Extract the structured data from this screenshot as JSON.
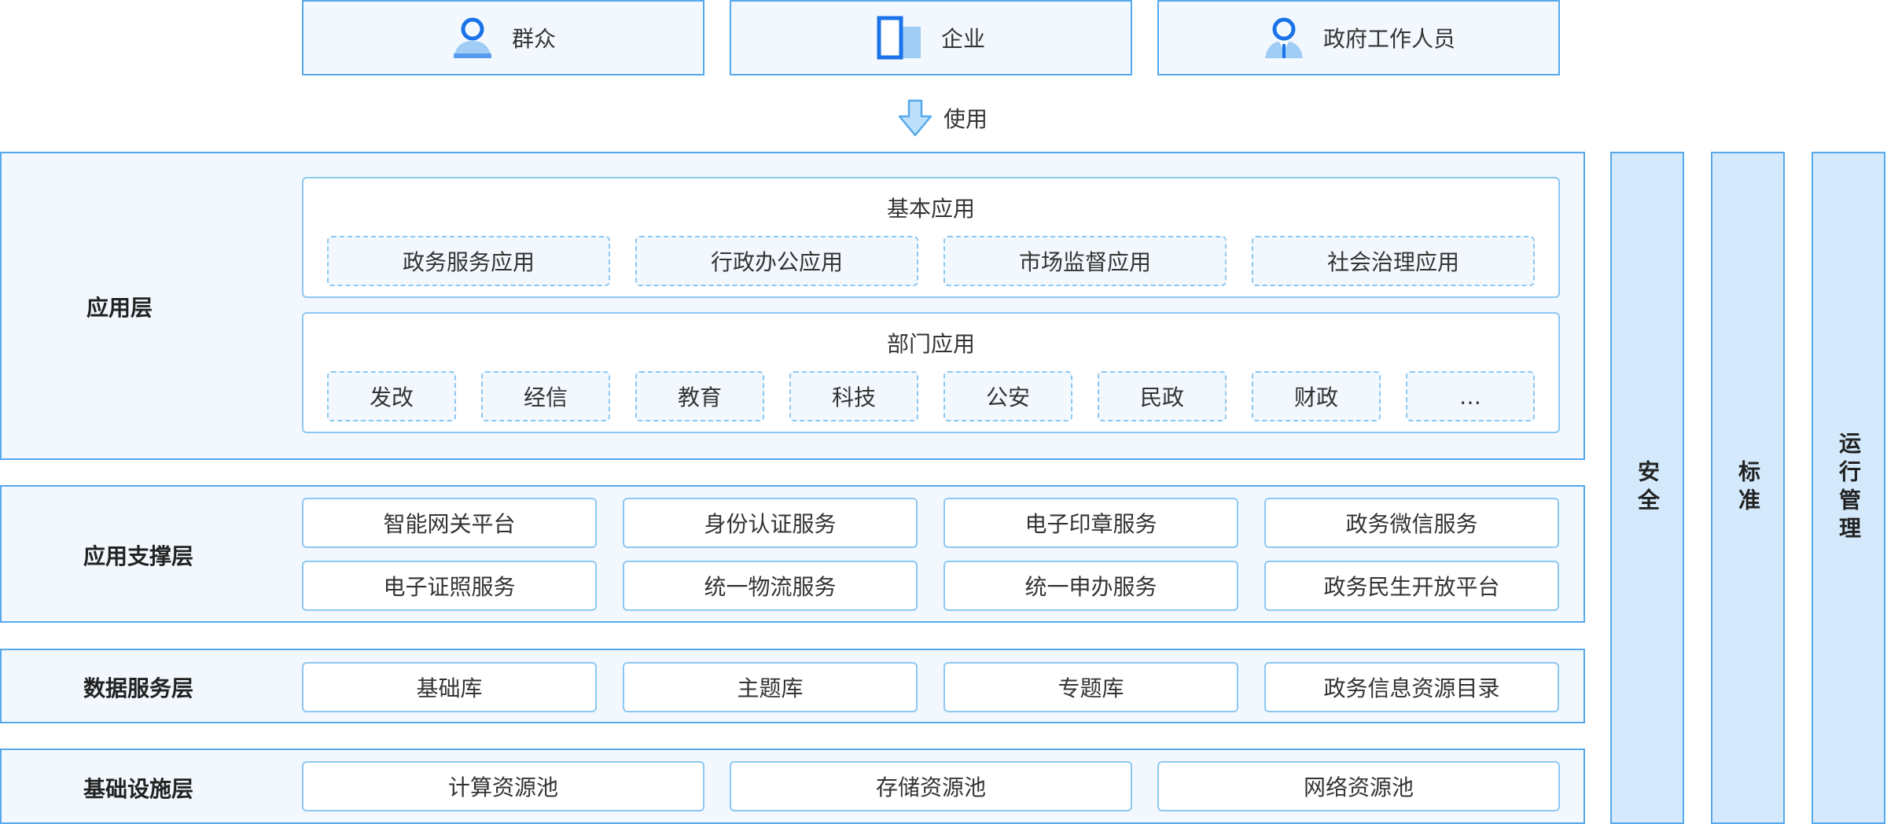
{
  "users": [
    {
      "label": "群众",
      "icon": "person-icon"
    },
    {
      "label": "企业",
      "icon": "building-icon"
    },
    {
      "label": "政府工作人员",
      "icon": "official-icon"
    }
  ],
  "use_label": "使用",
  "app_layer": {
    "title": "应用层",
    "basic": {
      "title": "基本应用",
      "items": [
        "政务服务应用",
        "行政办公应用",
        "市场监督应用",
        "社会治理应用"
      ]
    },
    "dept": {
      "title": "部门应用",
      "items": [
        "发改",
        "经信",
        "教育",
        "科技",
        "公安",
        "民政",
        "财政",
        "…"
      ]
    }
  },
  "support_layer": {
    "title": "应用支撑层",
    "row1": [
      "智能网关平台",
      "身份认证服务",
      "电子印章服务",
      "政务微信服务"
    ],
    "row2": [
      "电子证照服务",
      "统一物流服务",
      "统一申办服务",
      "政务民生开放平台"
    ]
  },
  "data_layer": {
    "title": "数据服务层",
    "items": [
      "基础库",
      "主题库",
      "专题库",
      "政务信息资源目录"
    ]
  },
  "infra_layer": {
    "title": "基础设施层",
    "items": [
      "计算资源池",
      "存储资源池",
      "网络资源池"
    ]
  },
  "side_columns": [
    "安全",
    "标准",
    "运行管理"
  ],
  "colors": {
    "border": "#55a9ec",
    "light_fill": "#f2f8fe",
    "side_fill": "#d4e9fb",
    "icon_blue": "#1a73e8",
    "icon_light": "#9fcdf5"
  }
}
